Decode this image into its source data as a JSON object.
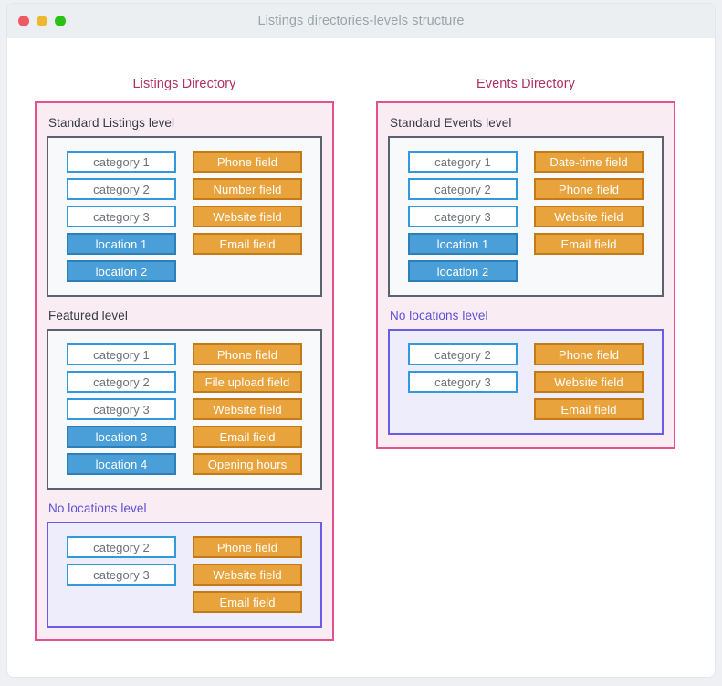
{
  "window": {
    "title": "Listings directories-levels structure",
    "controls": [
      {
        "name": "close",
        "color": "#ee5a63"
      },
      {
        "name": "minimize",
        "color": "#eeb730"
      },
      {
        "name": "maximize",
        "color": "#2bc113"
      }
    ]
  },
  "colors": {
    "directory_border": "#e1528f",
    "directory_background": "#faecf3",
    "directory_title": "#b03060",
    "level_border": "#5a6270",
    "level_background": "#f8f9fa",
    "level_border_purple": "#6b5ce7",
    "level_background_purple": "#eeedfb",
    "level_label": "#333a45",
    "level_label_purple": "#5b4fd6",
    "category_border": "#3399dd",
    "category_background": "#ffffff",
    "category_text": "#6a7179",
    "location_background": "#4a9fd8",
    "location_border": "#2c7fb8",
    "field_background": "#e8a33d",
    "field_border": "#c37a17",
    "chip_text_light": "#ffffff"
  },
  "columns": [
    {
      "title": "Listings Directory",
      "levels": [
        {
          "label": "Standard Listings level",
          "style": "standard",
          "taxonomies": [
            {
              "label": "category 1",
              "type": "category"
            },
            {
              "label": "category 2",
              "type": "category"
            },
            {
              "label": "category 3",
              "type": "category"
            },
            {
              "label": "location 1",
              "type": "location"
            },
            {
              "label": "location 2",
              "type": "location"
            }
          ],
          "fields": [
            {
              "label": "Phone field",
              "type": "field"
            },
            {
              "label": "Number field",
              "type": "field"
            },
            {
              "label": "Website field",
              "type": "field"
            },
            {
              "label": "Email field",
              "type": "field"
            }
          ]
        },
        {
          "label": "Featured level",
          "style": "standard",
          "taxonomies": [
            {
              "label": "category 1",
              "type": "category"
            },
            {
              "label": "category 2",
              "type": "category"
            },
            {
              "label": "category 3",
              "type": "category"
            },
            {
              "label": "location 3",
              "type": "location"
            },
            {
              "label": "location 4",
              "type": "location"
            }
          ],
          "fields": [
            {
              "label": "Phone field",
              "type": "field"
            },
            {
              "label": "File upload field",
              "type": "field"
            },
            {
              "label": "Website field",
              "type": "field"
            },
            {
              "label": "Email field",
              "type": "field"
            },
            {
              "label": "Opening hours",
              "type": "field"
            }
          ]
        },
        {
          "label": "No locations level",
          "style": "purple",
          "taxonomies": [
            {
              "label": "category 2",
              "type": "category"
            },
            {
              "label": "category 3",
              "type": "category"
            }
          ],
          "fields": [
            {
              "label": "Phone field",
              "type": "field"
            },
            {
              "label": "Website field",
              "type": "field"
            },
            {
              "label": "Email field",
              "type": "field"
            }
          ]
        }
      ]
    },
    {
      "title": "Events Directory",
      "levels": [
        {
          "label": "Standard Events level",
          "style": "standard",
          "taxonomies": [
            {
              "label": "category 1",
              "type": "category"
            },
            {
              "label": "category 2",
              "type": "category"
            },
            {
              "label": "category 3",
              "type": "category"
            },
            {
              "label": "location 1",
              "type": "location"
            },
            {
              "label": "location 2",
              "type": "location"
            }
          ],
          "fields": [
            {
              "label": "Date-time field",
              "type": "field"
            },
            {
              "label": "Phone field",
              "type": "field"
            },
            {
              "label": "Website field",
              "type": "field"
            },
            {
              "label": "Email field",
              "type": "field"
            }
          ]
        },
        {
          "label": "No locations level",
          "style": "purple",
          "taxonomies": [
            {
              "label": "category 2",
              "type": "category"
            },
            {
              "label": "category 3",
              "type": "category"
            }
          ],
          "fields": [
            {
              "label": "Phone field",
              "type": "field"
            },
            {
              "label": "Website field",
              "type": "field"
            },
            {
              "label": "Email field",
              "type": "field"
            }
          ]
        }
      ]
    }
  ]
}
